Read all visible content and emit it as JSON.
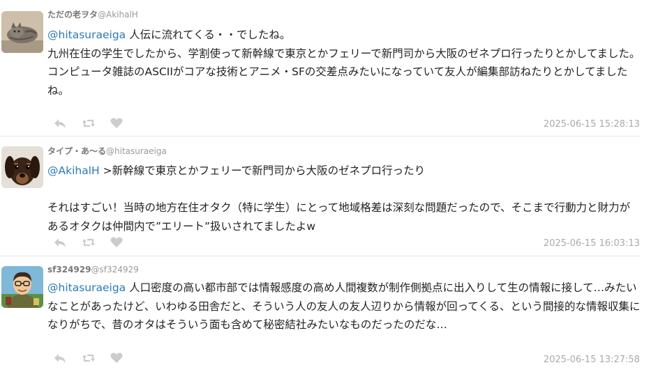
{
  "posts": [
    {
      "display_name": "ただの老ヲタ",
      "handle": "@AkihalH",
      "mention": "@hitasuraeiga",
      "text": " 人伝に流れてくる・・でしたね。\n九州在住の学生でしたから、学割使って新幹線で東京とかフェリーで新門司から大阪のゼネプロ行ったりとかしてました。\nコンピュータ雑誌のASCIIがコアな技術とアニメ・SFの交差点みたいになっていて友人が編集部訪ねたりとかしてましたね。",
      "timestamp": "2025-06-15 15:28:13",
      "avatar_icon": "cat-avatar-icon"
    },
    {
      "display_name": "タイプ・あ〜る",
      "handle": "@hitasuraeiga",
      "mention": "@AkihalH",
      "text": " >新幹線で東京とかフェリーで新門司から大阪のゼネプロ行ったり\n\nそれはすごい！当時の地方在住オタク（特に学生）にとって地域格差は深刻な問題だったので、そこまで行動力と財力があるオタクは仲間内で”エリート”扱いされてましたよw",
      "timestamp": "2025-06-15 16:03:13",
      "avatar_icon": "dog-avatar-icon"
    },
    {
      "display_name": "sf324929",
      "handle": "@sf324929",
      "mention": "@hitasuraeiga",
      "text": " 人口密度の高い都市部では情報感度の高め人間複数が制作側拠点に出入りして生の情報に接して…みたいなことがあったけど、いわゆる田舎だと、そういう人の友人の友人辺りから情報が回ってくる、という間接的な情報収集になりがちで、昔のオタはそういう面も含めて秘密結社みたいなものだったのだな…",
      "timestamp": "2025-06-15 13:27:58",
      "avatar_icon": "cartoon-person-avatar-icon"
    }
  ],
  "actions": {
    "reply_icon": "reply-icon",
    "retweet_icon": "retweet-icon",
    "like_icon": "heart-icon"
  },
  "colors": {
    "mention": "#2a7ab8",
    "timestamp": "#aaaaaa",
    "icon": "#cccccc",
    "divider": "#e8e8e8"
  }
}
